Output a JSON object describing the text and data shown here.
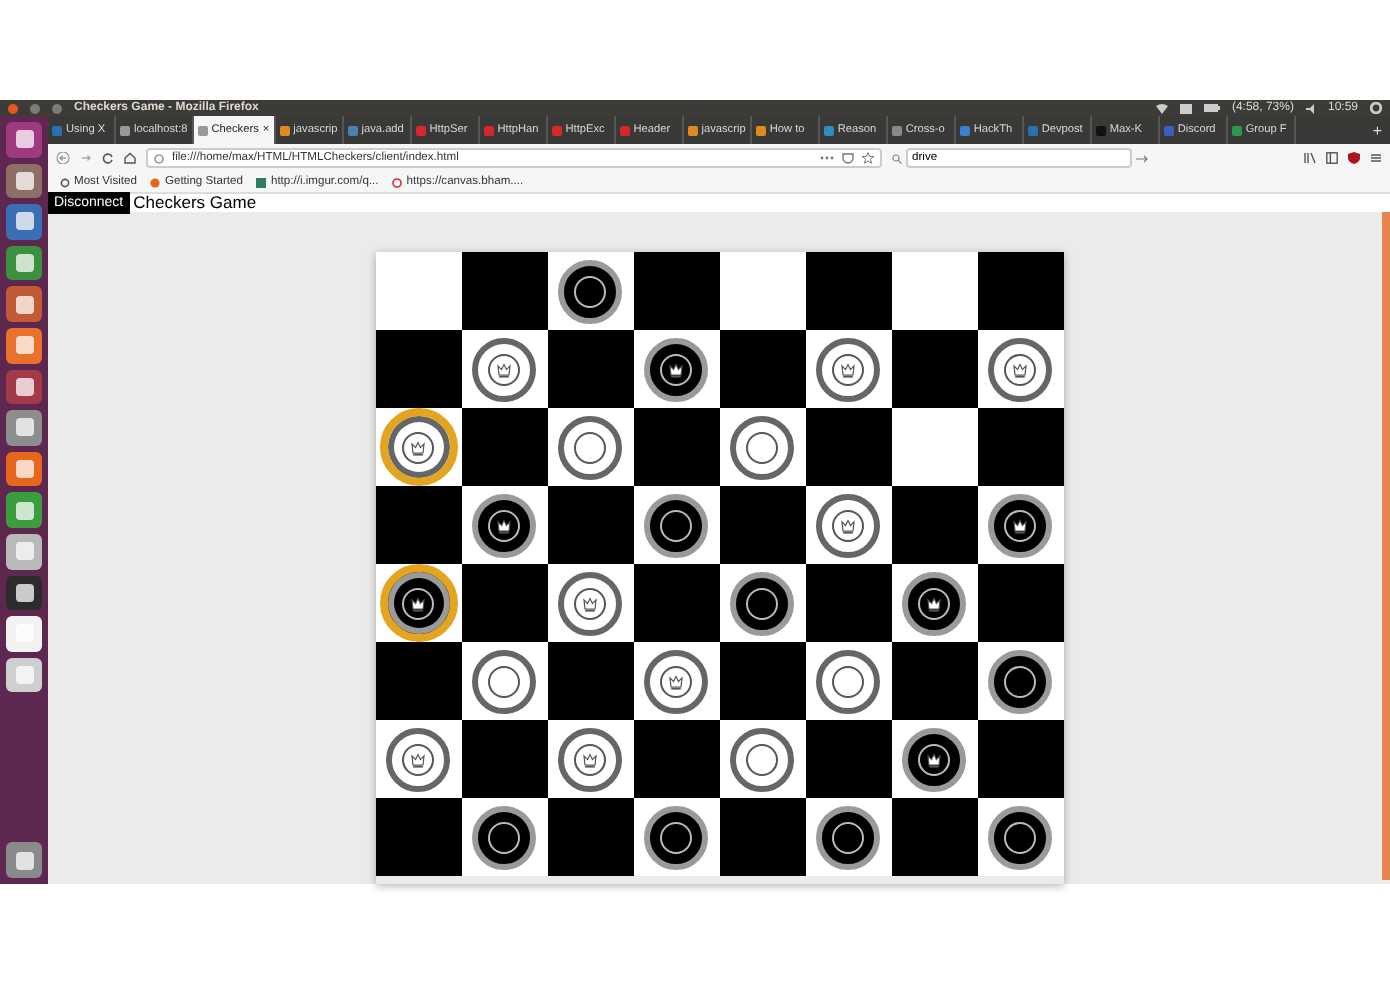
{
  "os_panel": {
    "title": "Checkers Game - Mozilla Firefox",
    "battery": "(4:58, 73%)",
    "clock": "10:59"
  },
  "tabs": {
    "close": "×",
    "new_tab": "+",
    "items": [
      {
        "label": "Using X",
        "selected": false,
        "color": "#2a6fb5"
      },
      {
        "label": "localhost:8",
        "selected": false,
        "color": "#999999"
      },
      {
        "label": "Checkers",
        "selected": true,
        "color": "#999999"
      },
      {
        "label": "javascrip",
        "selected": false,
        "color": "#e08a1e"
      },
      {
        "label": "java.add",
        "selected": false,
        "color": "#4a7fb0"
      },
      {
        "label": "HttpSer",
        "selected": false,
        "color": "#d9262a"
      },
      {
        "label": "HttpHan",
        "selected": false,
        "color": "#d9262a"
      },
      {
        "label": "HttpExc",
        "selected": false,
        "color": "#d9262a"
      },
      {
        "label": "Header",
        "selected": false,
        "color": "#d9262a"
      },
      {
        "label": "javascrip",
        "selected": false,
        "color": "#e08a1e"
      },
      {
        "label": "How to",
        "selected": false,
        "color": "#e08a1e"
      },
      {
        "label": "Reason",
        "selected": false,
        "color": "#2a8fc0"
      },
      {
        "label": "Cross-o",
        "selected": false,
        "color": "#888888"
      },
      {
        "label": "HackTh",
        "selected": false,
        "color": "#3a7fd0"
      },
      {
        "label": "Devpost",
        "selected": false,
        "color": "#2a70b0"
      },
      {
        "label": "Max-K",
        "selected": false,
        "color": "#111111"
      },
      {
        "label": "Discord",
        "selected": false,
        "color": "#3a5fc0"
      },
      {
        "label": "Group F",
        "selected": false,
        "color": "#2a9a4a"
      }
    ]
  },
  "address_bar": {
    "url": "file:///home/max/HTML/HTMLCheckers/client/index.html"
  },
  "search": {
    "value": "drive"
  },
  "bookmarks": [
    "Most Visited",
    "Getting Started",
    "http://i.imgur.com/q...",
    "https://canvas.bham...."
  ],
  "page": {
    "button": "Disconnect",
    "title": "Checkers Game"
  },
  "board": {
    "rows": [
      [
        {
          "kind": "light",
          "selected": false
        },
        {
          "kind": "dark",
          "selected": false
        },
        {
          "kind": "light",
          "selected": false,
          "piece": {
            "kind": "black",
            "king": false
          }
        },
        {
          "kind": "dark",
          "selected": false
        },
        {
          "kind": "light",
          "selected": false
        },
        {
          "kind": "dark",
          "selected": false
        },
        {
          "kind": "light",
          "selected": false
        },
        {
          "kind": "dark",
          "selected": false
        }
      ],
      [
        {
          "kind": "dark",
          "selected": false
        },
        {
          "kind": "light",
          "selected": false,
          "piece": {
            "kind": "white",
            "king": true
          }
        },
        {
          "kind": "dark",
          "selected": false
        },
        {
          "kind": "light",
          "selected": false,
          "piece": {
            "kind": "black",
            "king": true
          }
        },
        {
          "kind": "dark",
          "selected": false
        },
        {
          "kind": "light",
          "selected": false,
          "piece": {
            "kind": "white",
            "king": true
          }
        },
        {
          "kind": "dark",
          "selected": false
        },
        {
          "kind": "light",
          "selected": false,
          "piece": {
            "kind": "white",
            "king": true
          }
        }
      ],
      [
        {
          "kind": "light",
          "selected": true,
          "piece": {
            "kind": "white",
            "king": true
          }
        },
        {
          "kind": "dark",
          "selected": false
        },
        {
          "kind": "light",
          "selected": false,
          "piece": {
            "kind": "white",
            "king": false
          }
        },
        {
          "kind": "dark",
          "selected": false
        },
        {
          "kind": "light",
          "selected": false,
          "piece": {
            "kind": "white",
            "king": false
          }
        },
        {
          "kind": "dark",
          "selected": false
        },
        {
          "kind": "light",
          "selected": false
        },
        {
          "kind": "dark",
          "selected": false
        }
      ],
      [
        {
          "kind": "dark",
          "selected": false
        },
        {
          "kind": "light",
          "selected": false,
          "piece": {
            "kind": "black",
            "king": true
          }
        },
        {
          "kind": "dark",
          "selected": false
        },
        {
          "kind": "light",
          "selected": false,
          "piece": {
            "kind": "black",
            "king": false
          }
        },
        {
          "kind": "dark",
          "selected": false
        },
        {
          "kind": "light",
          "selected": false,
          "piece": {
            "kind": "white",
            "king": true
          }
        },
        {
          "kind": "dark",
          "selected": false
        },
        {
          "kind": "light",
          "selected": false,
          "piece": {
            "kind": "black",
            "king": true
          }
        }
      ],
      [
        {
          "kind": "light",
          "selected": true,
          "piece": {
            "kind": "black",
            "king": true
          }
        },
        {
          "kind": "dark",
          "selected": false
        },
        {
          "kind": "light",
          "selected": false,
          "piece": {
            "kind": "white",
            "king": true
          }
        },
        {
          "kind": "dark",
          "selected": false
        },
        {
          "kind": "light",
          "selected": false,
          "piece": {
            "kind": "black",
            "king": false
          }
        },
        {
          "kind": "dark",
          "selected": false
        },
        {
          "kind": "light",
          "selected": false,
          "piece": {
            "kind": "black",
            "king": true
          }
        },
        {
          "kind": "dark",
          "selected": false
        }
      ],
      [
        {
          "kind": "dark",
          "selected": false
        },
        {
          "kind": "light",
          "selected": false,
          "piece": {
            "kind": "white",
            "king": false
          }
        },
        {
          "kind": "dark",
          "selected": false
        },
        {
          "kind": "light",
          "selected": false,
          "piece": {
            "kind": "white",
            "king": true
          }
        },
        {
          "kind": "dark",
          "selected": false
        },
        {
          "kind": "light",
          "selected": false,
          "piece": {
            "kind": "white",
            "king": false
          }
        },
        {
          "kind": "dark",
          "selected": false
        },
        {
          "kind": "light",
          "selected": false,
          "piece": {
            "kind": "black",
            "king": false
          }
        }
      ],
      [
        {
          "kind": "light",
          "selected": false,
          "piece": {
            "kind": "white",
            "king": true
          }
        },
        {
          "kind": "dark",
          "selected": false
        },
        {
          "kind": "light",
          "selected": false,
          "piece": {
            "kind": "white",
            "king": true
          }
        },
        {
          "kind": "dark",
          "selected": false
        },
        {
          "kind": "light",
          "selected": false,
          "piece": {
            "kind": "white",
            "king": false
          }
        },
        {
          "kind": "dark",
          "selected": false
        },
        {
          "kind": "light",
          "selected": false,
          "piece": {
            "kind": "black",
            "king": true
          }
        },
        {
          "kind": "dark",
          "selected": false
        }
      ],
      [
        {
          "kind": "dark",
          "selected": false
        },
        {
          "kind": "light",
          "selected": false,
          "piece": {
            "kind": "black",
            "king": false
          }
        },
        {
          "kind": "dark",
          "selected": false
        },
        {
          "kind": "light",
          "selected": false,
          "piece": {
            "kind": "black",
            "king": false
          }
        },
        {
          "kind": "dark",
          "selected": false
        },
        {
          "kind": "light",
          "selected": false,
          "piece": {
            "kind": "black",
            "king": false
          }
        },
        {
          "kind": "dark",
          "selected": false
        },
        {
          "kind": "light",
          "selected": false,
          "piece": {
            "kind": "black",
            "king": false
          }
        }
      ]
    ]
  }
}
